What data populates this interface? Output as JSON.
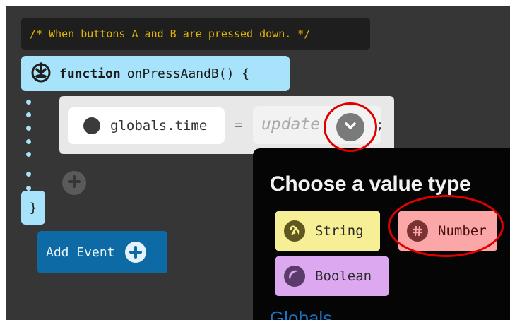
{
  "editor": {
    "comment": "/* When buttons A and B are pressed down. */",
    "function_keyword": "function",
    "function_name": "onPressAandB() {",
    "close_brace": "}",
    "statement": {
      "variable": "globals.time",
      "operator": "=",
      "value_placeholder": "update",
      "terminator": ";"
    },
    "add_event_label": "Add Event",
    "icons": {
      "event": "download-event-icon",
      "variable": "circle-icon",
      "dropdown": "chevron-down-icon",
      "add_statement": "plus-icon",
      "add_event": "plus-icon"
    }
  },
  "popup": {
    "title": "Choose a value type",
    "types": [
      {
        "label": "String",
        "icon": "string-icon",
        "color": "#f7ef95"
      },
      {
        "label": "Number",
        "icon": "hash-icon",
        "color": "#fba7a7"
      },
      {
        "label": "Boolean",
        "icon": "boolean-icon",
        "color": "#dca8f0"
      }
    ],
    "section_label": "Globals"
  },
  "colors": {
    "editor_bg": "#363636",
    "block_blue": "#a7e3fb",
    "add_event_bg": "#0e6aa4",
    "annotation": "#e00000"
  }
}
